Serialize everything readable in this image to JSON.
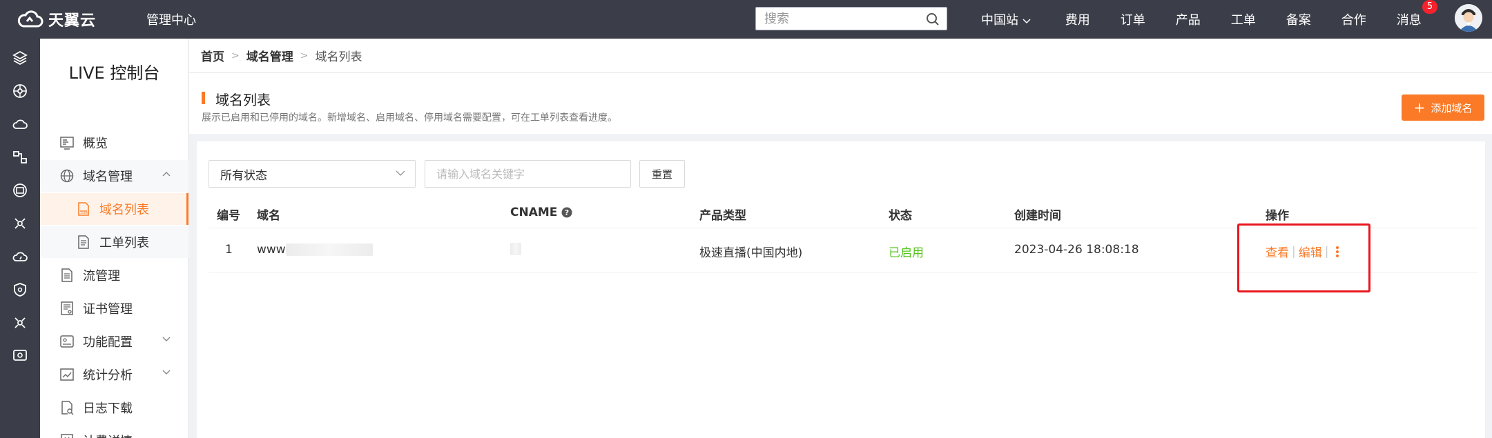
{
  "topbar": {
    "brand": "天翼云",
    "mgmt_center": "管理中心",
    "search_placeholder": "搜索",
    "nav": [
      "中国站",
      "费用",
      "订单",
      "产品",
      "工单",
      "备案",
      "合作",
      "消息"
    ],
    "message_badge": "5"
  },
  "sidebar": {
    "console_title": "LIVE 控制台",
    "items": {
      "overview": "概览",
      "domain_mgmt": "域名管理",
      "domain_list": "域名列表",
      "ticket_list": "工单列表",
      "stream_mgmt": "流管理",
      "cert_mgmt": "证书管理",
      "feature_config": "功能配置",
      "stats": "统计分析",
      "log_download": "日志下载",
      "billing": "计费详情"
    }
  },
  "breadcrumb": [
    "首页",
    "域名管理",
    "域名列表"
  ],
  "header": {
    "title": "域名列表",
    "description": "展示已启用和已停用的域名。新增域名、启用域名、停用域名需要配置，可在工单列表查看进度。",
    "add_button": "添加域名"
  },
  "filters": {
    "status_select": "所有状态",
    "keyword_placeholder": "请输入域名关键字",
    "reset_button": "重置"
  },
  "table": {
    "columns": {
      "no": "编号",
      "domain": "域名",
      "cname": "CNAME",
      "product_type": "产品类型",
      "status": "状态",
      "created": "创建时间",
      "actions": "操作"
    },
    "rows": [
      {
        "no": "1",
        "domain": "www",
        "product_type": "极速直播(中国内地)",
        "status": "已启用",
        "created": "2023-04-26 18:08:18",
        "view": "查看",
        "edit": "编辑"
      }
    ]
  },
  "colors": {
    "accent": "#fa7a27",
    "topbar": "#3b3e48",
    "status_enabled": "#52c41a",
    "highlight": "#e8161c"
  }
}
